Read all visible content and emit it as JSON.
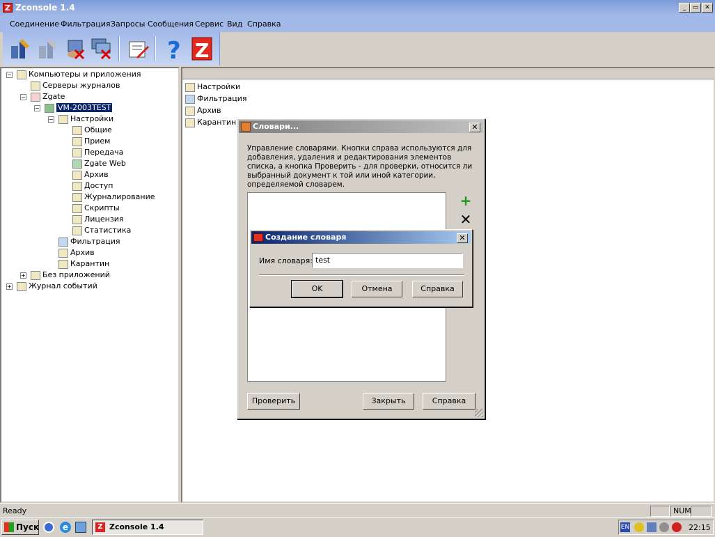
{
  "window": {
    "title": "Zconsole 1.4",
    "min": "_",
    "max": "▭",
    "close": "✕"
  },
  "menu": [
    "Соединение",
    "Фильтрация",
    "Запросы",
    "Сообщения",
    "Сервис",
    "Вид",
    "Справка"
  ],
  "toolbar": {
    "icons": [
      "connect-icon",
      "disconnect-icon",
      "remove-computer-icon",
      "remove-all-icon",
      "edit-icon",
      "help-icon",
      "zgate-icon"
    ]
  },
  "tree": {
    "root": "Компьютеры и приложения",
    "log_servers": "Серверы журналов",
    "zgate": "Zgate",
    "host": "VM-2003TEST",
    "settings": "Настройки",
    "items": [
      "Общие",
      "Прием",
      "Передача",
      "Zgate Web",
      "Архив",
      "Доступ",
      "Журналирование",
      "Скрипты",
      "Лицензия",
      "Статистика"
    ],
    "filtering": "Фильтрация",
    "archive": "Архив",
    "quarantine": "Карантин",
    "no_apps": "Без приложений",
    "event_log": "Журнал событий"
  },
  "right_list": [
    "Настройки",
    "Фильтрация",
    "Архив",
    "Карантин"
  ],
  "dict_dialog": {
    "title": "Словари...",
    "description": "Управление словарями. Кнопки справа используются для добавления, удаления и редактирования элементов списка, а кнопка Проверить - для проверки, относится ли выбранный документ к той или иной категории, определяемой словарем.",
    "check": "Проверить",
    "close": "Закрыть",
    "help": "Справка"
  },
  "create_dialog": {
    "title": "Создание словаря",
    "label": "Имя словаря:",
    "value": "test",
    "ok": "OK",
    "cancel": "Отмена",
    "help": "Справка"
  },
  "status": {
    "text": "Ready",
    "num": "NUM"
  },
  "taskbar": {
    "start": "Пуск",
    "task": "Zconsole 1.4",
    "lang": "EN",
    "clock": "22:15"
  },
  "colors": {
    "titlebar": "#7b9bd8",
    "menubar": "#a3b9e8",
    "selection": "#0a246a",
    "active_title": "#0a246a"
  }
}
